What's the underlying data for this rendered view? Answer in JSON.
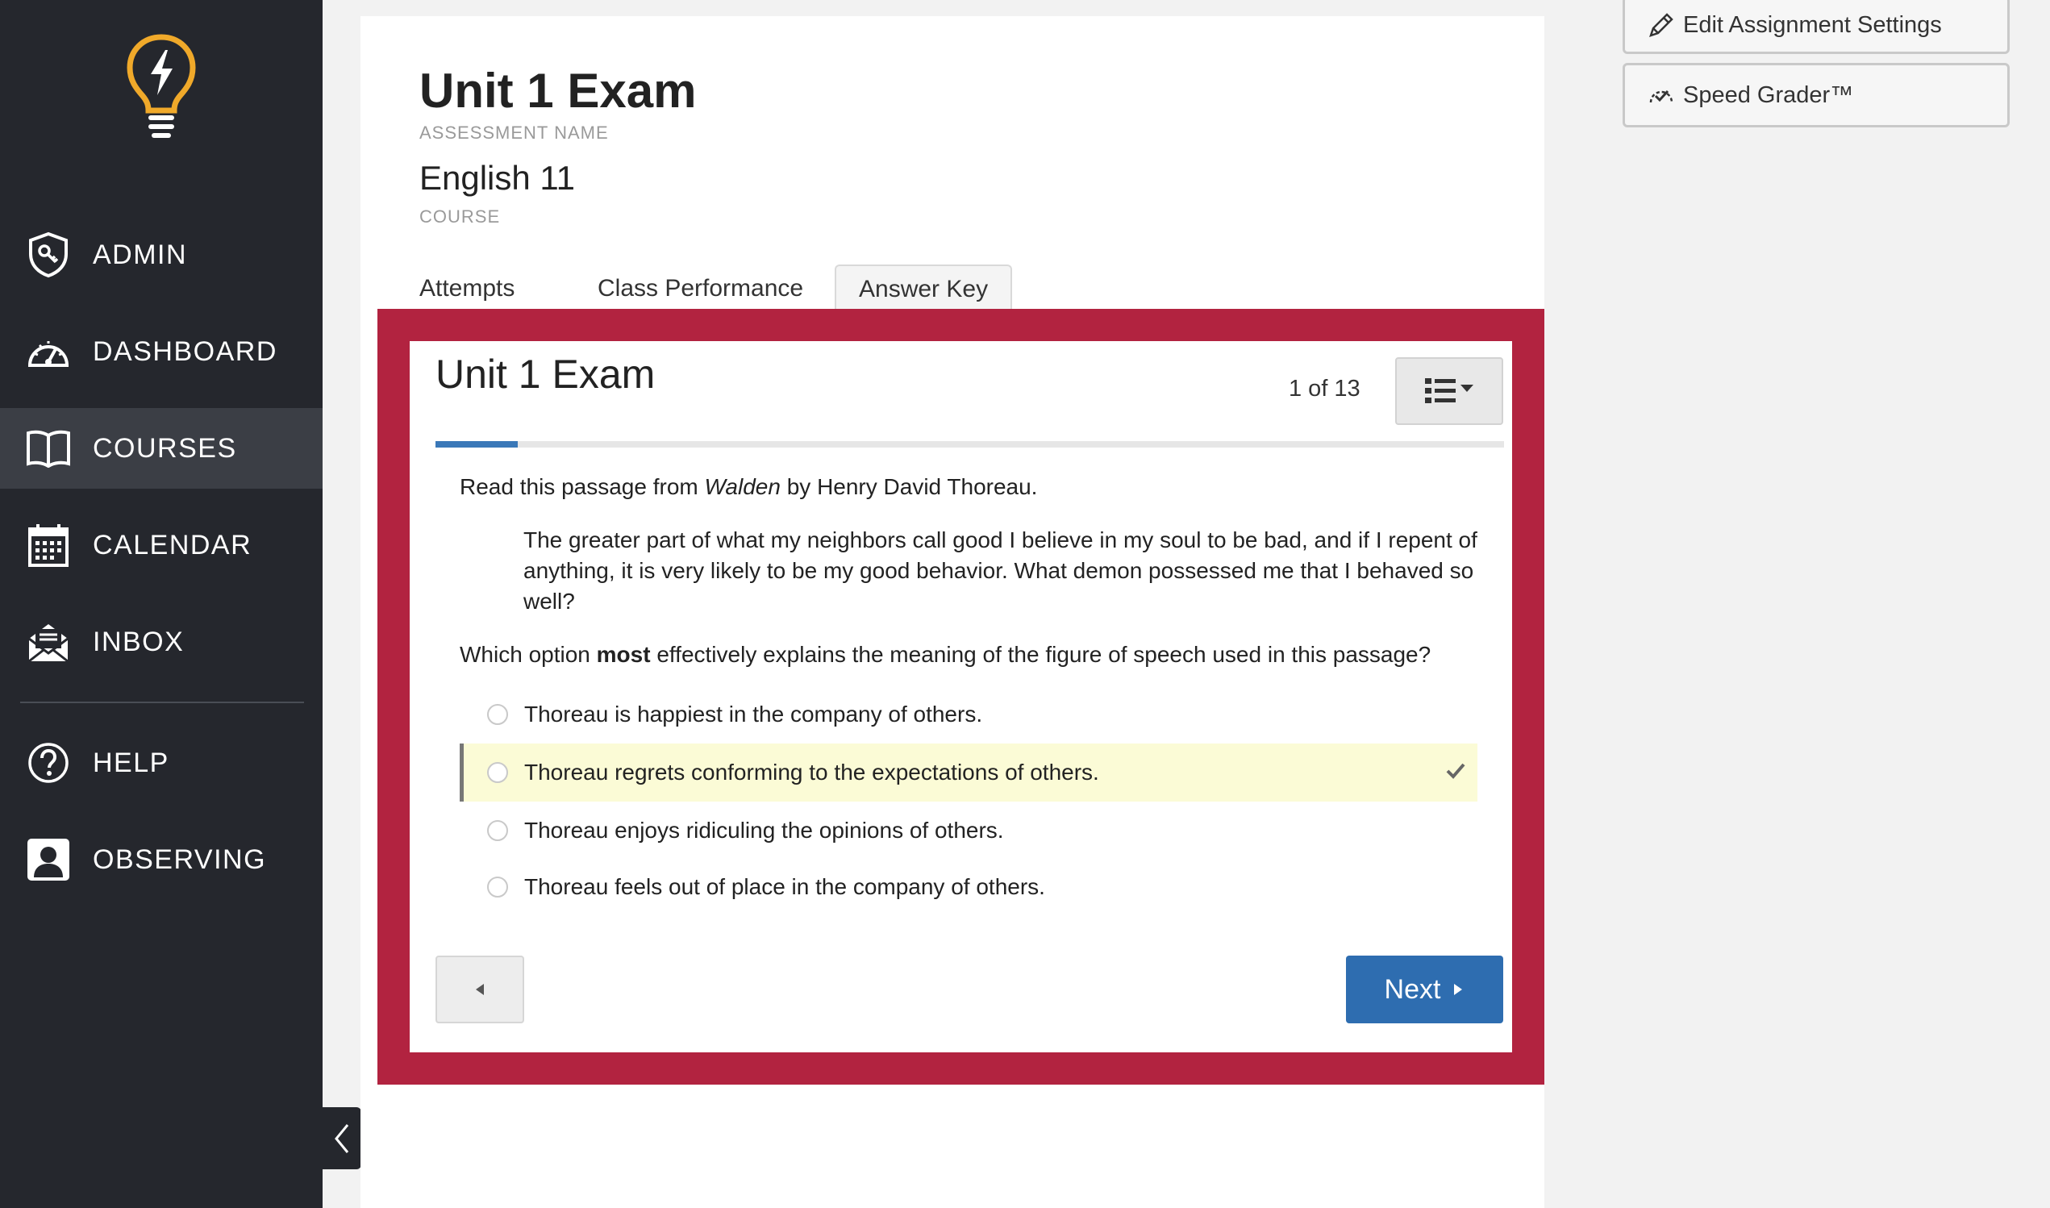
{
  "sidebar": {
    "items": [
      {
        "label": "ADMIN",
        "icon": "admin-shield-icon"
      },
      {
        "label": "DASHBOARD",
        "icon": "speedometer-icon"
      },
      {
        "label": "COURSES",
        "icon": "book-icon"
      },
      {
        "label": "CALENDAR",
        "icon": "calendar-icon"
      },
      {
        "label": "INBOX",
        "icon": "envelope-icon"
      },
      {
        "label": "HELP",
        "icon": "question-icon"
      },
      {
        "label": "OBSERVING",
        "icon": "person-icon"
      }
    ],
    "active": "COURSES"
  },
  "header": {
    "title": "Unit 1 Exam",
    "title_label": "ASSESSMENT NAME",
    "course": "English 11",
    "course_label": "COURSE"
  },
  "tabs": [
    {
      "label": "Attempts"
    },
    {
      "label": "Class Performance"
    },
    {
      "label": "Answer Key",
      "active": true
    }
  ],
  "side_buttons": {
    "edit": "Edit Assignment Settings",
    "grader": "Speed Grader™"
  },
  "quiz": {
    "title": "Unit 1 Exam",
    "counter": "1 of 13",
    "progress_fraction": 0.077,
    "intro_before": "Read this passage from ",
    "intro_work": "Walden",
    "intro_after": " by Henry David Thoreau.",
    "passage": "The greater part of what my neighbors call good I believe in my soul to be bad, and if I repent of anything, it is very likely to be my good behavior. What demon possessed me that I behaved so well?",
    "question_before": "Which option ",
    "question_bold": "most",
    "question_after": " effectively explains the meaning of the figure of speech used in this passage?",
    "options": [
      {
        "text": "Thoreau is happiest in the company of others."
      },
      {
        "text": "Thoreau regrets conforming to the expectations of others.",
        "correct": true
      },
      {
        "text": "Thoreau enjoys ridiculing the opinions of others."
      },
      {
        "text": "Thoreau feels out of place in the company of others."
      }
    ],
    "next_label": "Next"
  },
  "colors": {
    "sidebar_bg": "#25272d",
    "frame_red": "#b22340",
    "accent_blue": "#2e6db0",
    "correct_highlight": "#fbfbd6",
    "logo_gold": "#f0a92a"
  }
}
